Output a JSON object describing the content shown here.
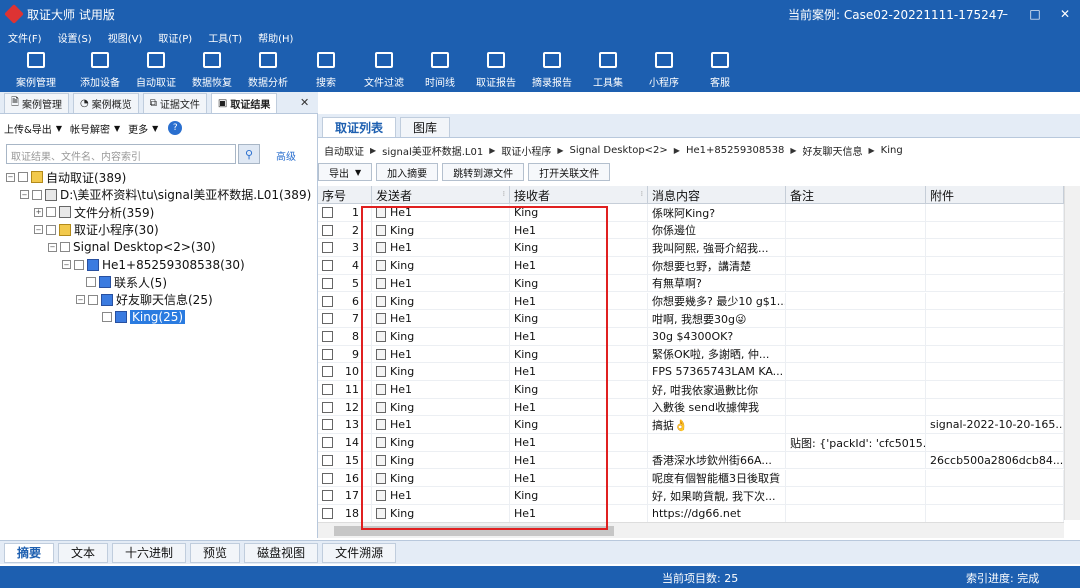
{
  "window": {
    "title": "取证大师 试用版",
    "case": "当前案例: Case02-20221111-175247",
    "minimize": "–",
    "maximize": "□",
    "close": "✕"
  },
  "menu": [
    "文件(F)",
    "设置(S)",
    "视图(V)",
    "取证(P)",
    "工具(T)",
    "帮助(H)"
  ],
  "toolbar": [
    {
      "label": "案例管理",
      "icon": "case-icon"
    },
    {
      "label": "添加设备",
      "icon": "device-icon"
    },
    {
      "label": "自动取证",
      "icon": "auto-icon"
    },
    {
      "label": "数据恢复",
      "icon": "recover-icon"
    },
    {
      "label": "数据分析",
      "icon": "analysis-icon"
    },
    {
      "label": "搜索",
      "icon": "search-icon"
    },
    {
      "label": "文件过滤",
      "icon": "filter-icon"
    },
    {
      "label": "时间线",
      "icon": "timeline-icon"
    },
    {
      "label": "取证报告",
      "icon": "report-icon"
    },
    {
      "label": "摘录报告",
      "icon": "excerpt-icon"
    },
    {
      "label": "工具集",
      "icon": "tools-icon"
    },
    {
      "label": "小程序",
      "icon": "miniapp-icon"
    },
    {
      "label": "客服",
      "icon": "support-icon"
    }
  ],
  "mainTabs": [
    "案例管理",
    "案例概览",
    "证据文件",
    "取证结果"
  ],
  "leftPane": {
    "upload": "上传&导出",
    "accountDecrypt": "帐号解密",
    "more": "更多",
    "help": "?",
    "searchPlaceholder": "取证结果、文件名、内容索引",
    "advanced": "高级"
  },
  "tree": [
    {
      "label": "自动取证(389)"
    },
    {
      "label": "D:\\美亚杯资料\\tu\\signal美亚杯数据.L01(389)"
    },
    {
      "label": "文件分析(359)"
    },
    {
      "label": "取证小程序(30)"
    },
    {
      "label": "Signal Desktop<2>(30)"
    },
    {
      "label": "He1+85259308538(30)"
    },
    {
      "label": "联系人(5)"
    },
    {
      "label": "好友聊天信息(25)"
    },
    {
      "label": "King(25)"
    }
  ],
  "rightTabs": [
    "取证列表",
    "图库"
  ],
  "breadcrumb": [
    "自动取证",
    "signal美亚杯数据.L01",
    "取证小程序",
    "Signal Desktop<2>",
    "He1+85259308538",
    "好友聊天信息",
    "King"
  ],
  "actions": {
    "export": "导出",
    "addExcerpt": "加入摘要",
    "jumpSource": "跳转到源文件",
    "openRelated": "打开关联文件"
  },
  "columns": [
    "序号",
    "发送者",
    "接收者",
    "消息内容",
    "备注",
    "附件"
  ],
  "rows": [
    {
      "no": "1",
      "sender": "He1",
      "receiver": "King",
      "msg": "係咪阿King?",
      "note": "",
      "attach": ""
    },
    {
      "no": "2",
      "sender": "King",
      "receiver": "He1",
      "msg": "你係邊位",
      "note": "",
      "attach": ""
    },
    {
      "no": "3",
      "sender": "He1",
      "receiver": "King",
      "msg": "我叫阿熙, 強哥介紹我...",
      "note": "",
      "attach": ""
    },
    {
      "no": "4",
      "sender": "King",
      "receiver": "He1",
      "msg": "你想要乜野，講清楚",
      "note": "",
      "attach": ""
    },
    {
      "no": "5",
      "sender": "He1",
      "receiver": "King",
      "msg": "有無草啊?",
      "note": "",
      "attach": ""
    },
    {
      "no": "6",
      "sender": "King",
      "receiver": "He1",
      "msg": "你想要幾多? 最少10 g$1...",
      "note": "",
      "attach": ""
    },
    {
      "no": "7",
      "sender": "He1",
      "receiver": "King",
      "msg": "咁啊, 我想要30g😜",
      "note": "",
      "attach": ""
    },
    {
      "no": "8",
      "sender": "King",
      "receiver": "He1",
      "msg": "30g $4300OK?",
      "note": "",
      "attach": ""
    },
    {
      "no": "9",
      "sender": "He1",
      "receiver": "King",
      "msg": "緊係OK啦, 多謝晒, 仲...",
      "note": "",
      "attach": ""
    },
    {
      "no": "10",
      "sender": "King",
      "receiver": "He1",
      "msg": "FPS 57365743LAM KA...",
      "note": "",
      "attach": ""
    },
    {
      "no": "11",
      "sender": "He1",
      "receiver": "King",
      "msg": "好, 咁我依家過數比你",
      "note": "",
      "attach": ""
    },
    {
      "no": "12",
      "sender": "King",
      "receiver": "He1",
      "msg": "入數後 send收據俾我",
      "note": "",
      "attach": ""
    },
    {
      "no": "13",
      "sender": "He1",
      "receiver": "King",
      "msg": "搞掂👌",
      "note": "",
      "attach": "signal-2022-10-20-165..."
    },
    {
      "no": "14",
      "sender": "King",
      "receiver": "He1",
      "msg": "",
      "note": "贴图: {'packId': 'cfc5015...",
      "attach": ""
    },
    {
      "no": "15",
      "sender": "King",
      "receiver": "He1",
      "msg": "香港深水埗欽州街66A...",
      "note": "",
      "attach": "26ccb500a2806dcb84..."
    },
    {
      "no": "16",
      "sender": "King",
      "receiver": "He1",
      "msg": "呢度有個智能櫃3日後取貨",
      "note": "",
      "attach": ""
    },
    {
      "no": "17",
      "sender": "He1",
      "receiver": "King",
      "msg": "好, 如果啲貨靚, 我下次...",
      "note": "",
      "attach": ""
    },
    {
      "no": "18",
      "sender": "King",
      "receiver": "He1",
      "msg": "https://dg66.net",
      "note": "",
      "attach": ""
    }
  ],
  "bottomTabs": [
    "摘要",
    "文本",
    "十六进制",
    "预览",
    "磁盘视图",
    "文件溯源"
  ],
  "status": {
    "count": "当前项目数: 25",
    "progress": "索引进度: 完成"
  }
}
